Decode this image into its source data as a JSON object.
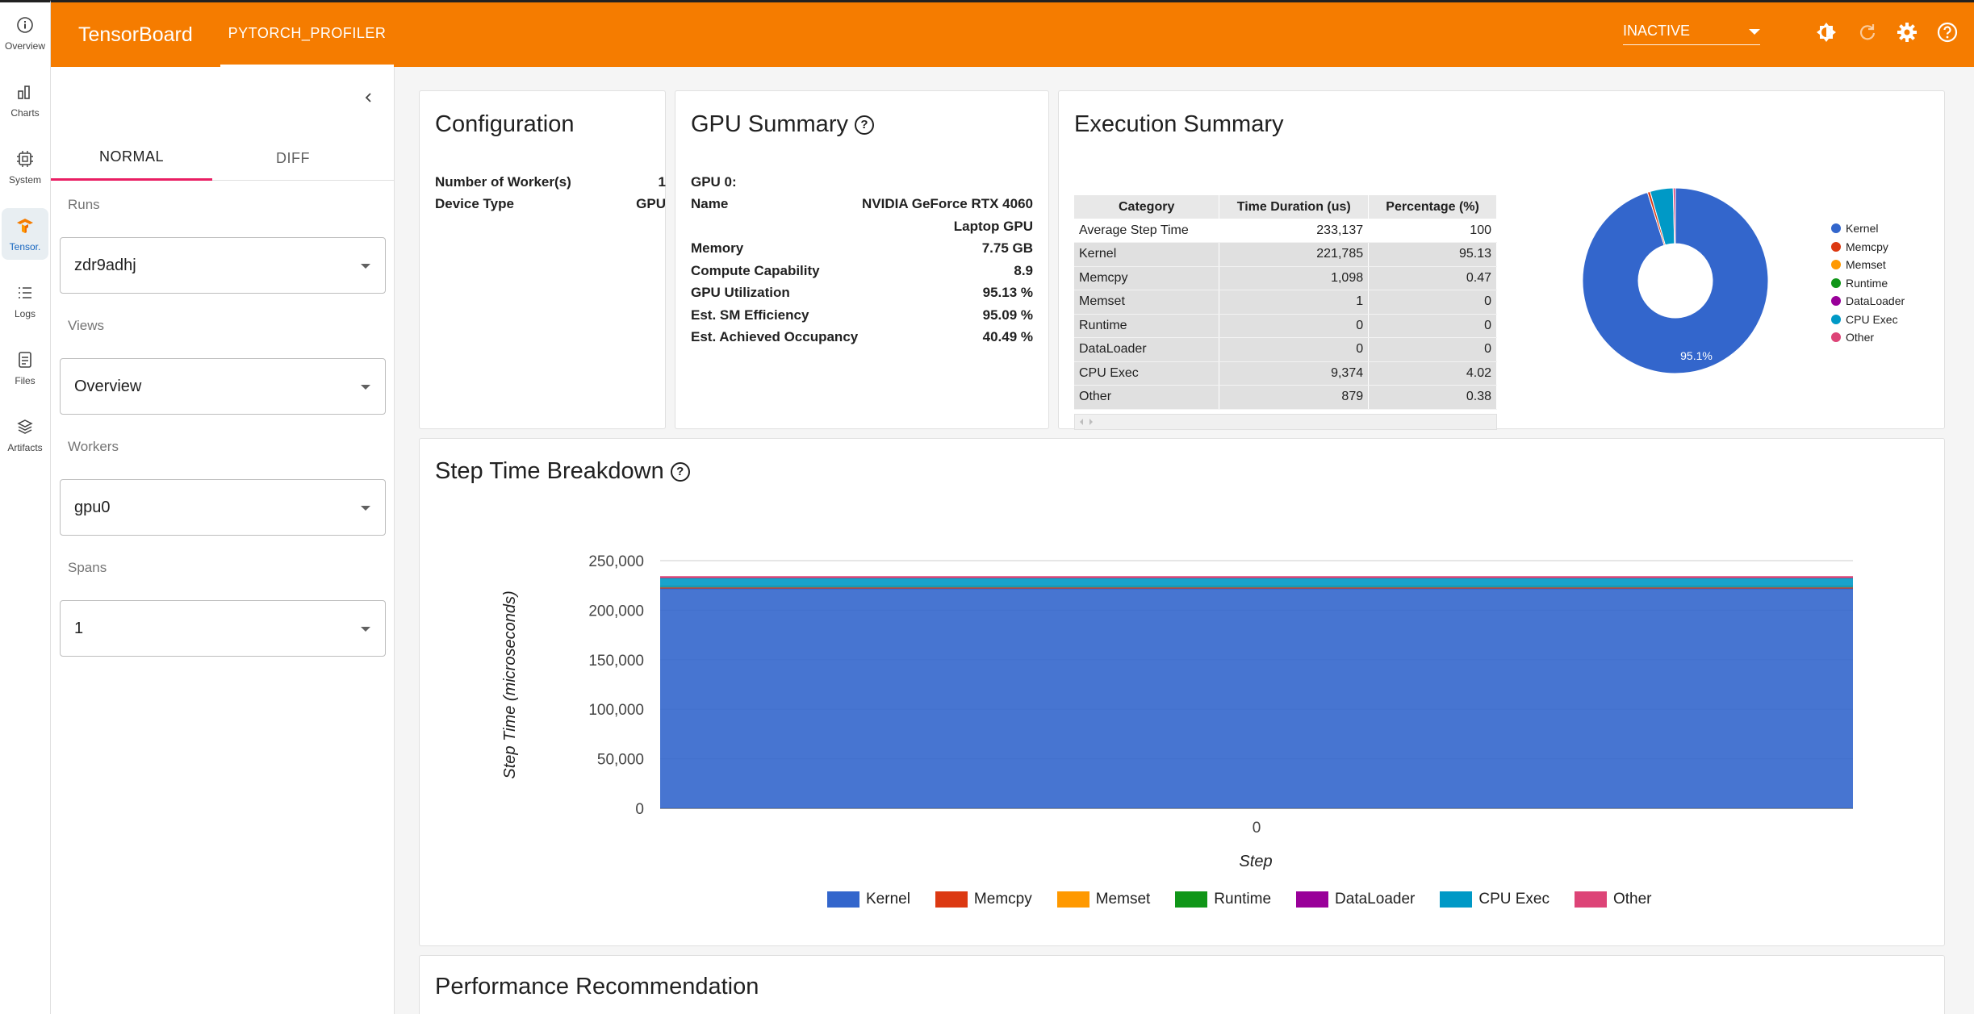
{
  "rail": [
    {
      "label": "Overview",
      "icon": "info-icon"
    },
    {
      "label": "Charts",
      "icon": "bar-chart-icon"
    },
    {
      "label": "System",
      "icon": "chip-icon"
    },
    {
      "label": "Tensor.",
      "icon": "tensorboard-icon"
    },
    {
      "label": "Logs",
      "icon": "list-icon"
    },
    {
      "label": "Files",
      "icon": "document-icon"
    },
    {
      "label": "Artifacts",
      "icon": "layers-icon"
    }
  ],
  "header": {
    "brand": "TensorBoard",
    "plugin_tab": "PYTORCH_PROFILER",
    "status": "INACTIVE",
    "colors": {
      "bar": "#f57c00"
    }
  },
  "sidebar": {
    "tabs": [
      "NORMAL",
      "DIFF"
    ],
    "runs_label": "Runs",
    "runs_value": "zdr9adhj",
    "views_label": "Views",
    "views_value": "Overview",
    "workers_label": "Workers",
    "workers_value": "gpu0",
    "spans_label": "Spans",
    "spans_value": "1"
  },
  "configuration": {
    "title": "Configuration",
    "rows": [
      {
        "k": "Number of Worker(s)",
        "v": "1"
      },
      {
        "k": "Device Type",
        "v": "GPU"
      }
    ]
  },
  "gpu_summary": {
    "title": "GPU Summary",
    "gpu_label": "GPU 0:",
    "name_key": "Name",
    "name_line1": "NVIDIA GeForce RTX 4060",
    "name_line2": "Laptop GPU",
    "rows": [
      {
        "k": "Memory",
        "v": "7.75 GB"
      },
      {
        "k": "Compute Capability",
        "v": "8.9"
      },
      {
        "k": "GPU Utilization",
        "v": "95.13 %"
      },
      {
        "k": "Est. SM Efficiency",
        "v": "95.09 %"
      },
      {
        "k": "Est. Achieved Occupancy",
        "v": "40.49 %"
      }
    ]
  },
  "execution": {
    "title": "Execution Summary",
    "columns": [
      "Category",
      "Time Duration (us)",
      "Percentage (%)"
    ],
    "rows": [
      [
        "Average Step Time",
        "233,137",
        "100"
      ],
      [
        "Kernel",
        "221,785",
        "95.13"
      ],
      [
        "Memcpy",
        "1,098",
        "0.47"
      ],
      [
        "Memset",
        "1",
        "0"
      ],
      [
        "Runtime",
        "0",
        "0"
      ],
      [
        "DataLoader",
        "0",
        "0"
      ],
      [
        "CPU Exec",
        "9,374",
        "4.02"
      ],
      [
        "Other",
        "879",
        "0.38"
      ]
    ],
    "pie_label": "95.1%",
    "legend": [
      "Kernel",
      "Memcpy",
      "Memset",
      "Runtime",
      "DataLoader",
      "CPU Exec",
      "Other"
    ]
  },
  "step_time": {
    "title": "Step Time Breakdown"
  },
  "performance": {
    "title": "Performance Recommendation"
  },
  "chart_data": [
    {
      "type": "pie",
      "categories": [
        "Kernel",
        "Memcpy",
        "Memset",
        "Runtime",
        "DataLoader",
        "CPU Exec",
        "Other"
      ],
      "values": [
        95.13,
        0.47,
        0,
        0,
        0,
        4.02,
        0.38
      ],
      "colors": [
        "#3366cc",
        "#dc3912",
        "#ff9900",
        "#109618",
        "#990099",
        "#0099c6",
        "#dd4477"
      ],
      "legend": "right"
    },
    {
      "type": "area",
      "x": [
        0
      ],
      "xlabel": "Step",
      "ylabel": "Step Time (microseconds)",
      "ylim": [
        0,
        250000
      ],
      "yticks": [
        "0",
        "50,000",
        "100,000",
        "150,000",
        "200,000",
        "250,000"
      ],
      "xticks": [
        "0"
      ],
      "stacked": true,
      "series": [
        {
          "name": "Kernel",
          "values": [
            221785
          ],
          "color": "#3366cc"
        },
        {
          "name": "Memcpy",
          "values": [
            1098
          ],
          "color": "#dc3912"
        },
        {
          "name": "Memset",
          "values": [
            1
          ],
          "color": "#ff9900"
        },
        {
          "name": "Runtime",
          "values": [
            0
          ],
          "color": "#109618"
        },
        {
          "name": "DataLoader",
          "values": [
            0
          ],
          "color": "#990099"
        },
        {
          "name": "CPU Exec",
          "values": [
            9374
          ],
          "color": "#0099c6"
        },
        {
          "name": "Other",
          "values": [
            879
          ],
          "color": "#dd4477"
        }
      ],
      "legend": "bottom"
    }
  ]
}
